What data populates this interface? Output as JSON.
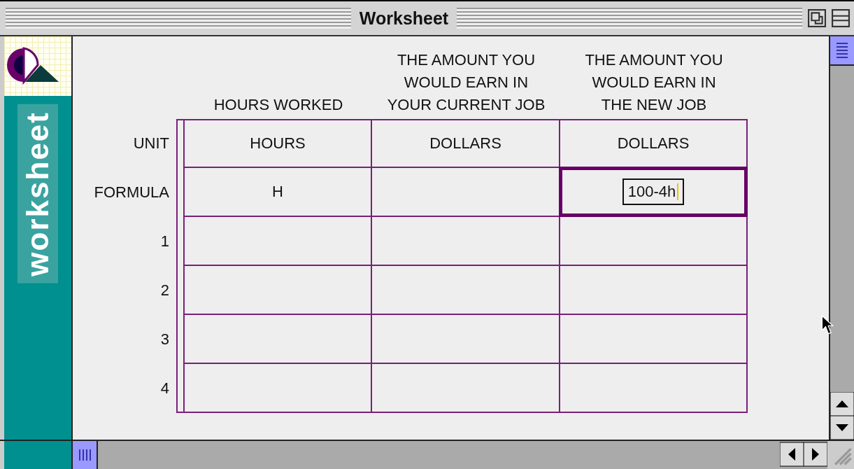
{
  "window": {
    "title": "Worksheet"
  },
  "sidebar": {
    "label": "worksheet"
  },
  "table": {
    "row_labels": {
      "unit": "UNIT",
      "formula": "FORMULA"
    },
    "columns": [
      {
        "heading": "HOURS WORKED",
        "unit": "HOURS",
        "formula": "H",
        "selected": false
      },
      {
        "heading": "THE AMOUNT YOU\nWOULD EARN IN\nYOUR CURRENT JOB",
        "unit": "DOLLARS",
        "selected": false
      },
      {
        "heading": "THE AMOUNT YOU\nWOULD EARN IN\nTHE NEW JOB",
        "unit": "DOLLARS",
        "formula": "100-4h",
        "selected": true
      }
    ],
    "rows": [
      {
        "label": "1"
      },
      {
        "label": "2"
      },
      {
        "label": "3"
      },
      {
        "label": "4"
      }
    ]
  }
}
